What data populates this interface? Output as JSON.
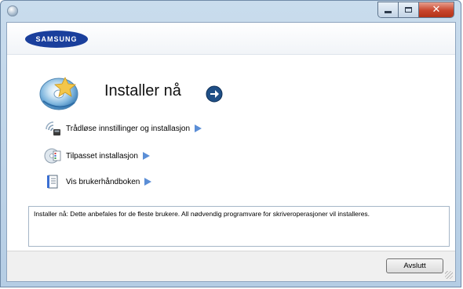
{
  "window": {
    "controls": {
      "minimize_icon": "minimize-icon",
      "maximize_icon": "maximize-icon",
      "close_icon": "close-icon",
      "close_glyph": "✕"
    }
  },
  "brand": {
    "logo_text": "SAMSUNG",
    "color": "#1a3f9c"
  },
  "hero": {
    "title": "Installer nå",
    "icon": "install-disc-icon",
    "go_icon": "arrow-right-circle-icon"
  },
  "options": [
    {
      "label": "Trådløse innstillinger og installasjon",
      "icon": "wireless-icon"
    },
    {
      "label": "Tilpasset installasjon",
      "icon": "custom-install-disc-icon"
    },
    {
      "label": "Vis brukerhåndboken",
      "icon": "user-manual-icon"
    }
  ],
  "description": {
    "text": "Installer nå: Dette anbefales for de fleste brukere. All nødvendig programvare for skriveroperasjoner vil installeres."
  },
  "footer": {
    "exit_label": "Avslutt"
  },
  "colors": {
    "accent_arrow": "#5b8ed6",
    "title_bar": "#c9dced"
  }
}
